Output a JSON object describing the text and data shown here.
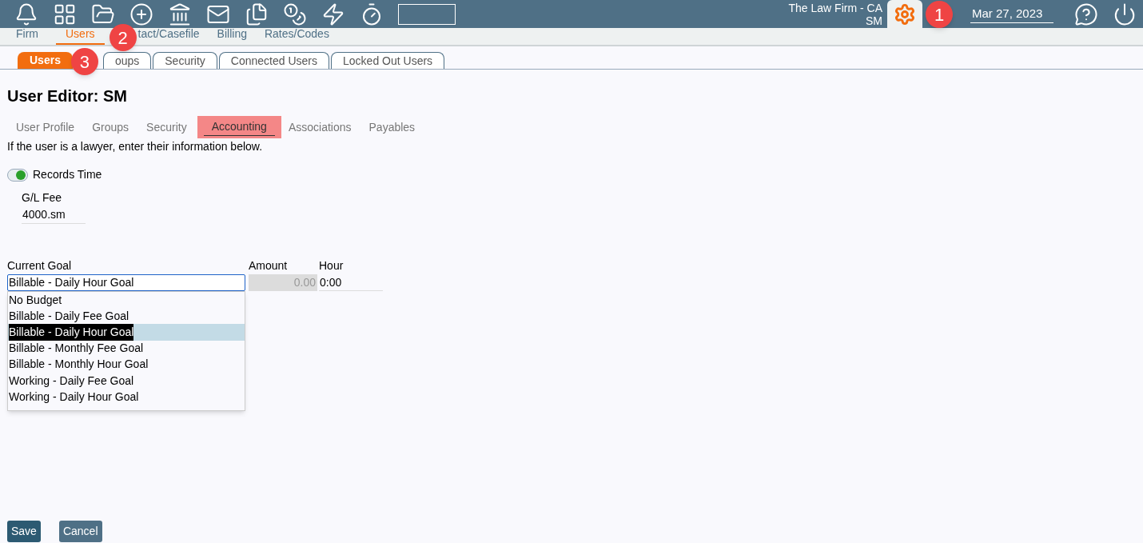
{
  "top_bar": {
    "icons": [
      {
        "kind": "bell"
      },
      {
        "kind": "grid"
      },
      {
        "kind": "folder"
      },
      {
        "kind": "plus"
      },
      {
        "kind": "bank"
      },
      {
        "kind": "mail"
      },
      {
        "kind": "files"
      },
      {
        "kind": "coins"
      },
      {
        "kind": "zap"
      },
      {
        "kind": "timer"
      }
    ],
    "firm": "The Law Firm - CA",
    "user": "SM",
    "date": "Mar 27, 2023"
  },
  "nav": [
    {
      "label": "Firm",
      "selected": false
    },
    {
      "label": "Users",
      "selected": true
    },
    {
      "label": "tact/Casefile",
      "selected": false
    },
    {
      "label": "Billing",
      "selected": false
    },
    {
      "label": "Rates/Codes",
      "selected": false
    }
  ],
  "tabs": [
    {
      "label": "Users",
      "selected": true
    },
    {
      "label": "oups",
      "selected": false
    },
    {
      "label": "Security",
      "selected": false
    },
    {
      "label": "Connected Users",
      "selected": false
    },
    {
      "label": "Locked Out Users",
      "selected": false
    }
  ],
  "callouts": [
    "1",
    "2",
    "3"
  ],
  "title": "User Editor: SM",
  "subtabs": [
    {
      "label": "User Profile",
      "selected": false
    },
    {
      "label": "Groups",
      "selected": false
    },
    {
      "label": "Security",
      "selected": false
    },
    {
      "label": "Accounting",
      "selected": true
    },
    {
      "label": "Associations",
      "selected": false
    },
    {
      "label": "Payables",
      "selected": false
    }
  ],
  "intro": "If the user is a lawyer, enter their information below.",
  "records_time": {
    "label": "Records Time",
    "on": true
  },
  "gl_fee": {
    "label": "G/L Fee",
    "value": "4000.sm"
  },
  "goal": {
    "label": "Current Goal",
    "value": "Billable - Daily Hour Goal",
    "options": [
      {
        "label": "No Budget",
        "selected": false
      },
      {
        "label": "Billable - Daily Fee Goal",
        "selected": false
      },
      {
        "label": "Billable - Daily Hour Goal",
        "selected": true
      },
      {
        "label": "Billable - Monthly Fee Goal",
        "selected": false
      },
      {
        "label": "Billable - Monthly Hour Goal",
        "selected": false
      },
      {
        "label": "Working - Daily Fee Goal",
        "selected": false
      },
      {
        "label": "Working - Daily Hour Goal",
        "selected": false
      }
    ]
  },
  "amount": {
    "label": "Amount",
    "value": "0.00",
    "disabled": true
  },
  "hour": {
    "label": "Hour",
    "value": "0:00"
  },
  "buttons": [
    "Save",
    "Cancel"
  ]
}
